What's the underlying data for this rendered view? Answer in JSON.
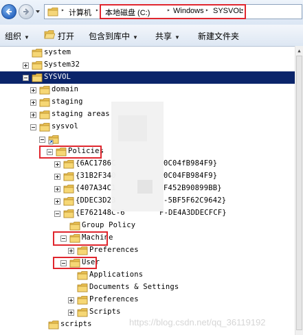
{
  "address_bar": {
    "crumbs": [
      "计算机",
      "本地磁盘 (C:)",
      "Windows",
      "SYSVOL"
    ]
  },
  "toolbar": {
    "organize": "组织",
    "open": "打开",
    "include_in_library": "包含到库中",
    "share": "共享",
    "new_folder": "新建文件夹"
  },
  "tree": {
    "rows": [
      {
        "label": "system",
        "depth": 0,
        "expander": "none"
      },
      {
        "label": "System32",
        "depth": 0,
        "expander": "plus"
      },
      {
        "label": "SYSVOL",
        "depth": 0,
        "expander": "minus",
        "selected": true
      },
      {
        "label": "domain",
        "depth": 1,
        "expander": "plus"
      },
      {
        "label": "staging",
        "depth": 1,
        "expander": "plus"
      },
      {
        "label": "staging areas",
        "depth": 1,
        "expander": "plus"
      },
      {
        "label": "sysvol",
        "depth": 1,
        "expander": "minus"
      },
      {
        "label": "",
        "depth": 2,
        "expander": "minus",
        "shortcut": true
      },
      {
        "label": "Policies",
        "depth": 3,
        "expander": "minus"
      },
      {
        "label": "{6AC1786C",
        "label_end": "0C04fB984F9}",
        "depth": 4,
        "expander": "plus"
      },
      {
        "label": "{31B2F340",
        "label_end": "0C04FB984F9}",
        "depth": 4,
        "expander": "plus"
      },
      {
        "label": "{407A34C1",
        "label_end": "F452B90899BB}",
        "depth": 4,
        "expander": "plus"
      },
      {
        "label": "{DDEC3D23",
        "label_end": "-5BF5F62C9642}",
        "depth": 4,
        "expander": "plus"
      },
      {
        "label": "{E762148C-6",
        "label_end": "F-DE4A3DDECFCF}",
        "depth": 4,
        "expander": "minus"
      },
      {
        "label": "Group Policy",
        "depth": 5,
        "expander": "none"
      },
      {
        "label": "Machine",
        "depth": 5,
        "expander": "minus"
      },
      {
        "label": "Preferences",
        "depth": 6,
        "expander": "plus"
      },
      {
        "label": "User",
        "depth": 5,
        "expander": "minus"
      },
      {
        "label": "Applications",
        "depth": 6,
        "expander": "none"
      },
      {
        "label": "Documents & Settings",
        "depth": 6,
        "expander": "none"
      },
      {
        "label": "Preferences",
        "depth": 6,
        "expander": "plus"
      },
      {
        "label": "Scripts",
        "depth": 6,
        "expander": "plus"
      },
      {
        "label": "scripts",
        "depth": 2,
        "expander": "none"
      }
    ]
  },
  "watermark": "https://blog.csdn.net/qq_36119192",
  "colors": {
    "selection": "#0a246a",
    "highlight_box": "#e0252d",
    "folder": "#e8bf52"
  },
  "icons": {
    "back": "back-arrow-icon",
    "forward": "forward-arrow-icon",
    "folder": "folder-icon",
    "open": "open-folder-icon"
  }
}
